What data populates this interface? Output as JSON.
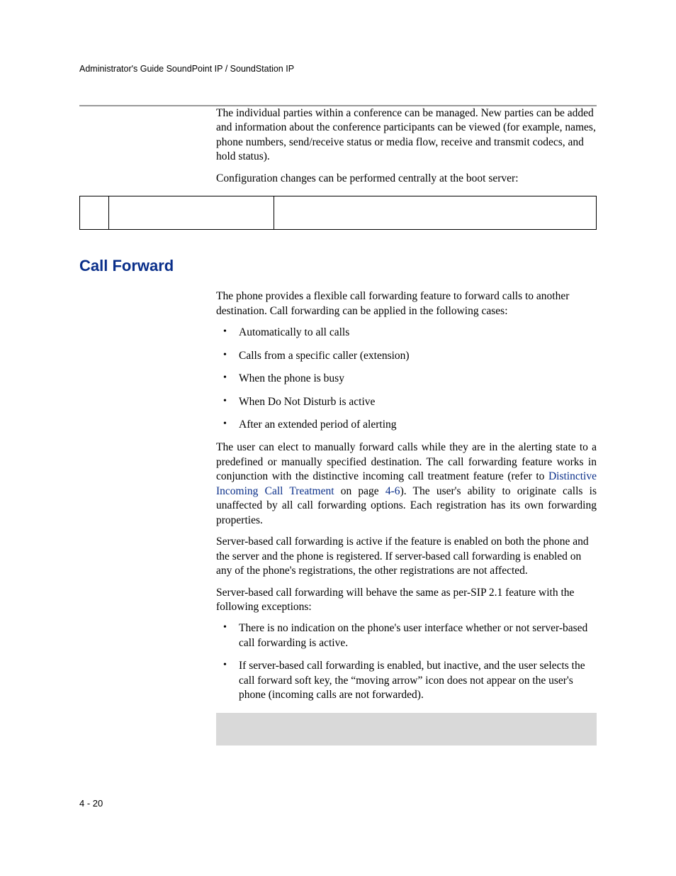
{
  "header": {
    "running": "Administrator's Guide SoundPoint IP / SoundStation IP"
  },
  "intro": {
    "p1": "The individual parties within a conference can be managed. New parties can be added and information about the conference participants can be viewed (for example, names, phone numbers, send/receive status or media flow, receive and transmit codecs, and hold status).",
    "p2": "Configuration changes can be performed centrally at the boot server:"
  },
  "section": {
    "heading": "Call Forward",
    "p1": "The phone provides a flexible call forwarding feature to forward calls to another destination. Call forwarding can be applied in the following cases:",
    "bullets1": [
      "Automatically to all calls",
      "Calls from a specific caller (extension)",
      "When the phone is busy",
      "When Do Not Disturb is active",
      "After an extended period of alerting"
    ],
    "p2a": "The user can elect to manually forward calls while they are in the alerting state to a predefined or manually specified destination. The call forwarding feature works in conjunction with the distinctive incoming call treatment feature (refer to ",
    "p2_link": "Distinctive Incoming Call Treatment",
    "p2b": " on page ",
    "p2_pageref": "4-6",
    "p2c": "). The user's ability to originate calls is unaffected by all call forwarding options. Each registration has its own forwarding properties.",
    "p3": "Server-based call forwarding is active if the feature is enabled on both the phone and the server and the phone is registered. If server-based call forwarding is enabled on any of the phone's registrations, the other registrations are not affected.",
    "p4": "Server-based call forwarding will behave the same as per-SIP 2.1 feature with the following exceptions:",
    "bullets2": [
      "There is no indication on the phone's user interface whether or not server-based call forwarding is active.",
      "If server-based call forwarding is enabled, but inactive, and the user selects the call forward soft key, the “moving arrow” icon does not appear on the user's phone (incoming calls are not forwarded)."
    ]
  },
  "footer": {
    "page_number": "4 - 20"
  }
}
